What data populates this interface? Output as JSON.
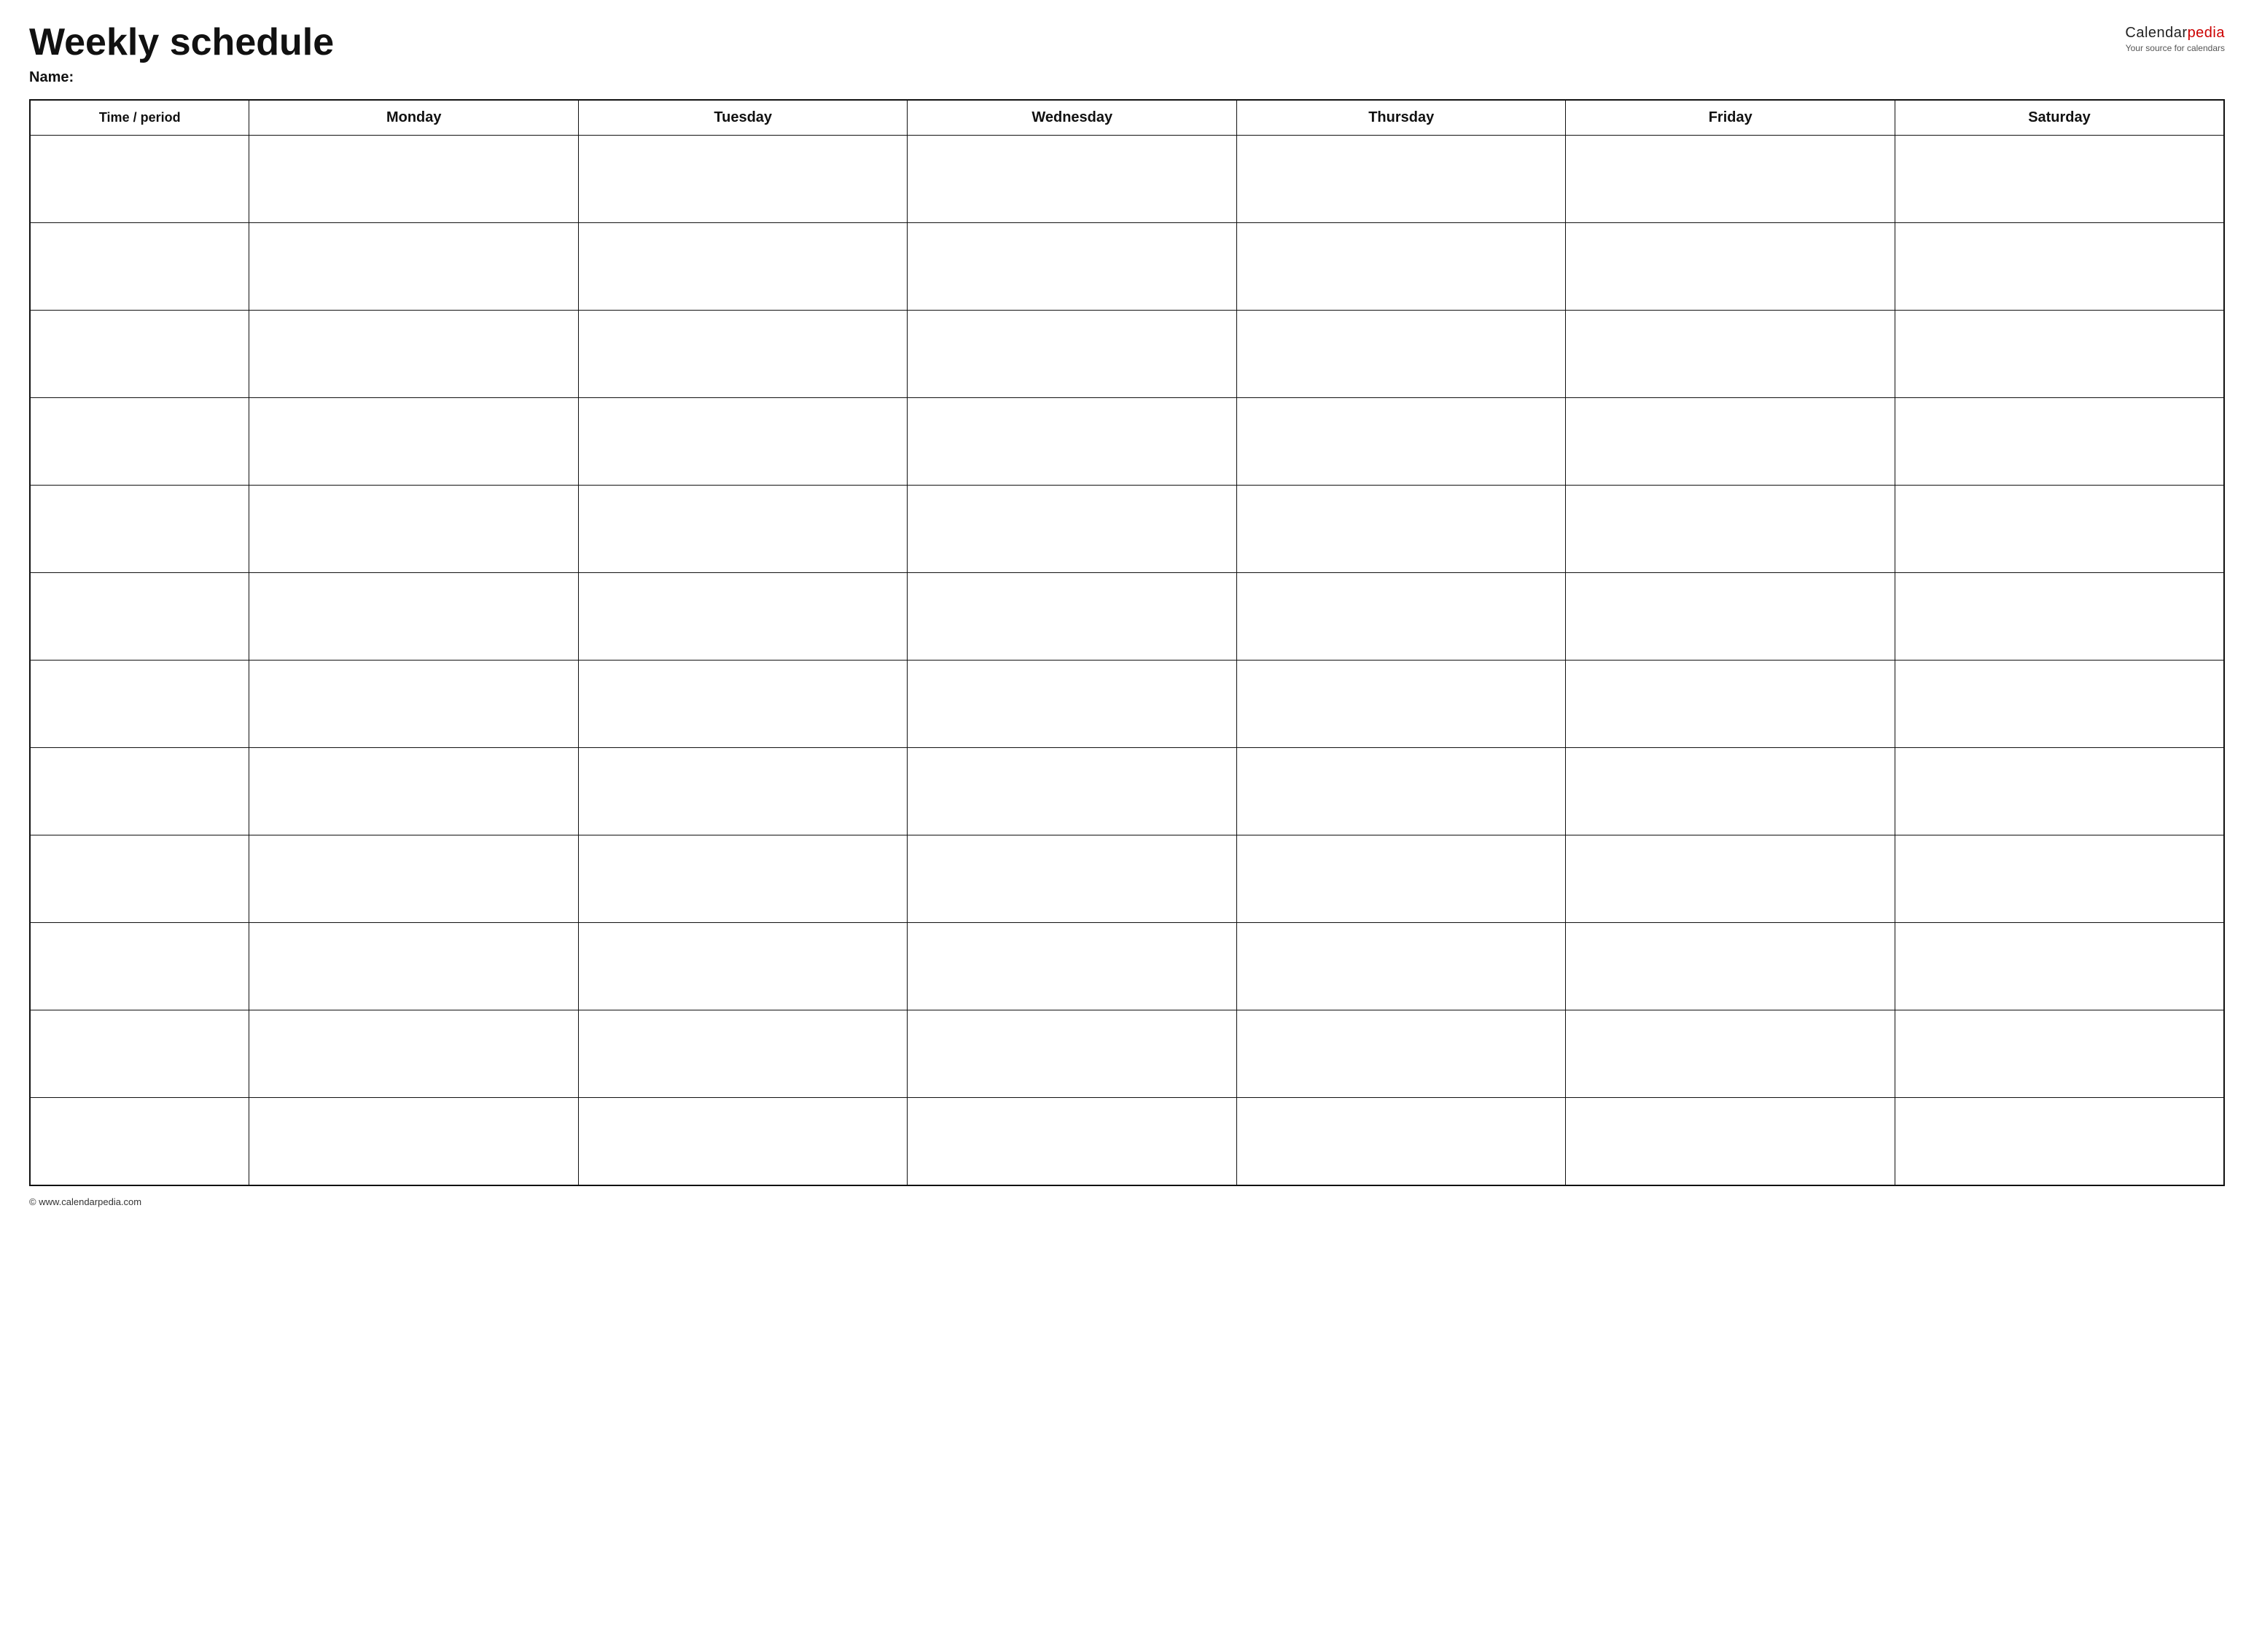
{
  "header": {
    "title": "Weekly schedule",
    "logo": {
      "brand": "Calendar",
      "brand_accent": "pedia",
      "tagline": "Your source for calendars"
    }
  },
  "name_label": "Name:",
  "table": {
    "columns": [
      {
        "key": "time",
        "label": "Time / period"
      },
      {
        "key": "monday",
        "label": "Monday"
      },
      {
        "key": "tuesday",
        "label": "Tuesday"
      },
      {
        "key": "wednesday",
        "label": "Wednesday"
      },
      {
        "key": "thursday",
        "label": "Thursday"
      },
      {
        "key": "friday",
        "label": "Friday"
      },
      {
        "key": "saturday",
        "label": "Saturday"
      }
    ],
    "row_count": 12
  },
  "footer": {
    "text": "© www.calendarpedia.com"
  }
}
